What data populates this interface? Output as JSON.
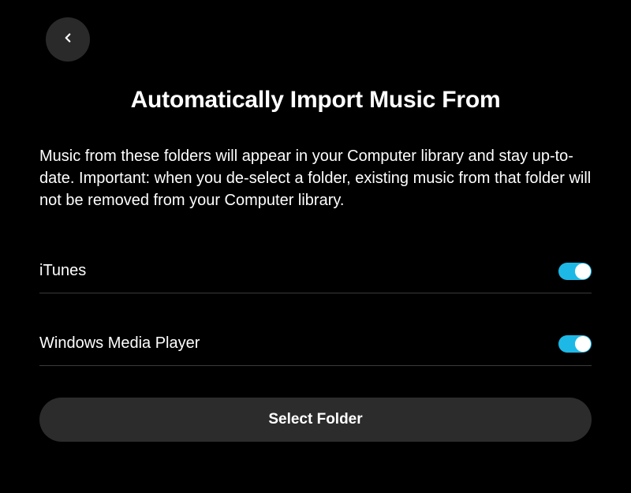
{
  "header": {
    "title": "Automatically Import Music From"
  },
  "description": "Music from these folders will appear in your Computer library and stay up-to-date. Important: when you de-select a folder, existing music from that folder will not be removed from your Computer library.",
  "options": [
    {
      "label": "iTunes",
      "enabled": true
    },
    {
      "label": "Windows Media Player",
      "enabled": true
    }
  ],
  "actions": {
    "select_folder_label": "Select Folder"
  }
}
